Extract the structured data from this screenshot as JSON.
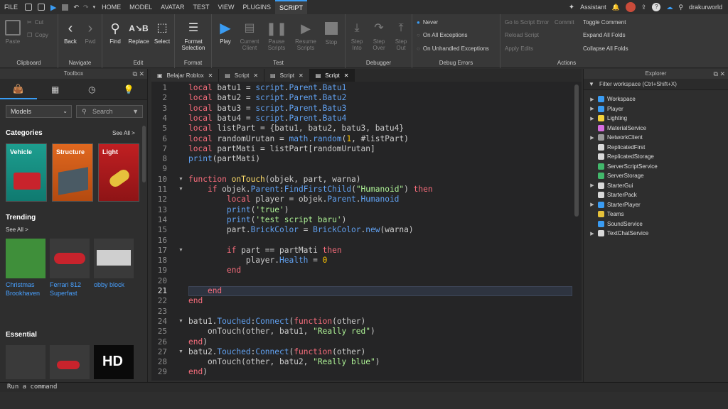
{
  "menu": {
    "file": "FILE",
    "tabs": [
      "HOME",
      "MODEL",
      "AVATAR",
      "TEST",
      "VIEW",
      "PLUGINS",
      "SCRIPT"
    ],
    "assistant": "Assistant",
    "username": "drakurworld"
  },
  "ribbon": {
    "clipboard": {
      "label": "Clipboard",
      "paste": "Paste",
      "cut": "Cut",
      "copy": "Copy"
    },
    "navigate": {
      "label": "Navigate",
      "back": "Back",
      "fwd": "Fwd"
    },
    "edit": {
      "label": "Edit",
      "find": "Find",
      "replace": "Replace",
      "select": "Select"
    },
    "format": {
      "label": "Format",
      "format_selection": "Format Selection"
    },
    "test": {
      "label": "Test",
      "play": "Play",
      "current_client": "Current Client",
      "pause_scripts": "Pause Scripts",
      "resume_scripts": "Resume Scripts",
      "stop": "Stop"
    },
    "debugger": {
      "label": "Debugger",
      "step_into": "Step Into",
      "step_over": "Step Over",
      "step_out": "Step Out"
    },
    "debug_errors": {
      "label": "Debug Errors",
      "never": "Never",
      "all_exceptions": "On All Exceptions",
      "unhandled": "On Unhandled Exceptions"
    },
    "actions": {
      "label": "Actions",
      "go_to_error": "Go to Script Error",
      "commit": "Commit",
      "reload": "Reload Script",
      "apply": "Apply Edits",
      "toggle_comment": "Toggle Comment",
      "expand_folds": "Expand All Folds",
      "collapse_folds": "Collapse All Folds"
    }
  },
  "toolbox": {
    "title": "Toolbox",
    "category_select": "Models",
    "search_placeholder": "Search",
    "categories_title": "Categories",
    "see_all": "See All >",
    "categories": [
      "Vehicle",
      "Structure",
      "Light"
    ],
    "trending_title": "Trending",
    "trending": [
      "Christmas Brookhaven",
      "Ferrari 812 Superfast",
      "obby block"
    ],
    "essential_title": "Essential",
    "essential_icon_text": "HD"
  },
  "editor": {
    "tabs": [
      "Belajar Roblox",
      "Script",
      "Script",
      "Script"
    ],
    "active_tab": 3,
    "current_line": 21
  },
  "explorer": {
    "title": "Explorer",
    "filter_placeholder": "Filter workspace (Ctrl+Shift+X)",
    "items": [
      {
        "name": "Workspace",
        "expand": true,
        "color": "#3a9cf3"
      },
      {
        "name": "Player",
        "expand": true,
        "color": "#3a9cf3"
      },
      {
        "name": "Lighting",
        "expand": true,
        "color": "#f3d23a"
      },
      {
        "name": "MaterialService",
        "expand": false,
        "color": "#d66de0"
      },
      {
        "name": "NetworkClient",
        "expand": true,
        "color": "#9a9a9a"
      },
      {
        "name": "ReplicatedFirst",
        "expand": false,
        "color": "#d9d9d9"
      },
      {
        "name": "ReplicatedStorage",
        "expand": false,
        "color": "#d9d9d9"
      },
      {
        "name": "ServerScriptService",
        "expand": false,
        "color": "#42b86b"
      },
      {
        "name": "ServerStorage",
        "expand": false,
        "color": "#42b86b"
      },
      {
        "name": "StarterGui",
        "expand": true,
        "color": "#d9d9d9"
      },
      {
        "name": "StarterPack",
        "expand": false,
        "color": "#d9d9d9"
      },
      {
        "name": "StarterPlayer",
        "expand": true,
        "color": "#3a9cf3"
      },
      {
        "name": "Teams",
        "expand": false,
        "color": "#e6c13a"
      },
      {
        "name": "SoundService",
        "expand": false,
        "color": "#3a9cf3"
      },
      {
        "name": "TextChatService",
        "expand": true,
        "color": "#d9d9d9"
      }
    ]
  },
  "code_lines": [
    [
      [
        "kw",
        "local"
      ],
      [
        "tx",
        " batu1 = "
      ],
      [
        "pr",
        "script"
      ],
      [
        "tx",
        "."
      ],
      [
        "pr",
        "Parent"
      ],
      [
        "tx",
        "."
      ],
      [
        "pr",
        "Batu1"
      ]
    ],
    [
      [
        "kw",
        "local"
      ],
      [
        "tx",
        " batu2 = "
      ],
      [
        "pr",
        "script"
      ],
      [
        "tx",
        "."
      ],
      [
        "pr",
        "Parent"
      ],
      [
        "tx",
        "."
      ],
      [
        "pr",
        "Batu2"
      ]
    ],
    [
      [
        "kw",
        "local"
      ],
      [
        "tx",
        " batu3 = "
      ],
      [
        "pr",
        "script"
      ],
      [
        "tx",
        "."
      ],
      [
        "pr",
        "Parent"
      ],
      [
        "tx",
        "."
      ],
      [
        "pr",
        "Batu3"
      ]
    ],
    [
      [
        "kw",
        "local"
      ],
      [
        "tx",
        " batu4 = "
      ],
      [
        "pr",
        "script"
      ],
      [
        "tx",
        "."
      ],
      [
        "pr",
        "Parent"
      ],
      [
        "tx",
        "."
      ],
      [
        "pr",
        "Batu4"
      ]
    ],
    [
      [
        "kw",
        "local"
      ],
      [
        "tx",
        " listPart = {batu1, batu2, batu3, batu4}"
      ]
    ],
    [
      [
        "kw",
        "local"
      ],
      [
        "tx",
        " randomUrutan = "
      ],
      [
        "pr",
        "math"
      ],
      [
        "tx",
        "."
      ],
      [
        "pr",
        "random"
      ],
      [
        "tx",
        "("
      ],
      [
        "nu",
        "1"
      ],
      [
        "tx",
        ", #listPart)"
      ]
    ],
    [
      [
        "kw",
        "local"
      ],
      [
        "tx",
        " partMati = listPart[randomUrutan]"
      ]
    ],
    [
      [
        "pr",
        "print"
      ],
      [
        "tx",
        "(partMati)"
      ]
    ],
    [],
    [
      [
        "kw",
        "function"
      ],
      [
        "tx",
        " "
      ],
      [
        "fn",
        "onTouch"
      ],
      [
        "tx",
        "(objek, part, warna)"
      ]
    ],
    [
      [
        "tx",
        "    "
      ],
      [
        "kw",
        "if"
      ],
      [
        "tx",
        " objek."
      ],
      [
        "pr",
        "Parent"
      ],
      [
        "tx",
        ":"
      ],
      [
        "pr",
        "FindFirstChild"
      ],
      [
        "tx",
        "("
      ],
      [
        "st",
        "\"Humanoid\""
      ],
      [
        "tx",
        ") "
      ],
      [
        "kw",
        "then"
      ]
    ],
    [
      [
        "tx",
        "        "
      ],
      [
        "kw",
        "local"
      ],
      [
        "tx",
        " player = objek."
      ],
      [
        "pr",
        "Parent"
      ],
      [
        "tx",
        "."
      ],
      [
        "pr",
        "Humanoid"
      ]
    ],
    [
      [
        "tx",
        "        "
      ],
      [
        "pr",
        "print"
      ],
      [
        "tx",
        "("
      ],
      [
        "st",
        "'true'"
      ],
      [
        "tx",
        ")"
      ]
    ],
    [
      [
        "tx",
        "        "
      ],
      [
        "pr",
        "print"
      ],
      [
        "tx",
        "("
      ],
      [
        "st",
        "'test script baru'"
      ],
      [
        "tx",
        ")"
      ]
    ],
    [
      [
        "tx",
        "        part."
      ],
      [
        "pr",
        "BrickColor"
      ],
      [
        "tx",
        " = "
      ],
      [
        "pr",
        "BrickColor"
      ],
      [
        "tx",
        "."
      ],
      [
        "pr",
        "new"
      ],
      [
        "tx",
        "(warna)"
      ]
    ],
    [],
    [
      [
        "tx",
        "        "
      ],
      [
        "kw",
        "if"
      ],
      [
        "tx",
        " part == partMati "
      ],
      [
        "kw",
        "then"
      ]
    ],
    [
      [
        "tx",
        "            player."
      ],
      [
        "pr",
        "Health"
      ],
      [
        "tx",
        " = "
      ],
      [
        "nu",
        "0"
      ]
    ],
    [
      [
        "tx",
        "        "
      ],
      [
        "kw",
        "end"
      ]
    ],
    [],
    [
      [
        "tx",
        "    "
      ],
      [
        "kw",
        "end"
      ]
    ],
    [
      [
        "kw",
        "end"
      ]
    ],
    [],
    [
      [
        "tx",
        "batu1."
      ],
      [
        "pr",
        "Touched"
      ],
      [
        "tx",
        ":"
      ],
      [
        "pr",
        "Connect"
      ],
      [
        "tx",
        "("
      ],
      [
        "kw",
        "function"
      ],
      [
        "tx",
        "(other)"
      ]
    ],
    [
      [
        "tx",
        "    onTouch(other, batu1, "
      ],
      [
        "st",
        "\"Really red\""
      ],
      [
        "tx",
        ")"
      ]
    ],
    [
      [
        "kw",
        "end"
      ],
      [
        "tx",
        ")"
      ]
    ],
    [
      [
        "tx",
        "batu2."
      ],
      [
        "pr",
        "Touched"
      ],
      [
        "tx",
        ":"
      ],
      [
        "pr",
        "Connect"
      ],
      [
        "tx",
        "("
      ],
      [
        "kw",
        "function"
      ],
      [
        "tx",
        "(other)"
      ]
    ],
    [
      [
        "tx",
        "    onTouch(other, batu2, "
      ],
      [
        "st",
        "\"Really blue\""
      ],
      [
        "tx",
        ")"
      ]
    ],
    [
      [
        "kw",
        "end"
      ],
      [
        "tx",
        ")"
      ]
    ]
  ],
  "folds": [
    10,
    11,
    17,
    24,
    27
  ],
  "command_bar": "Run a command"
}
